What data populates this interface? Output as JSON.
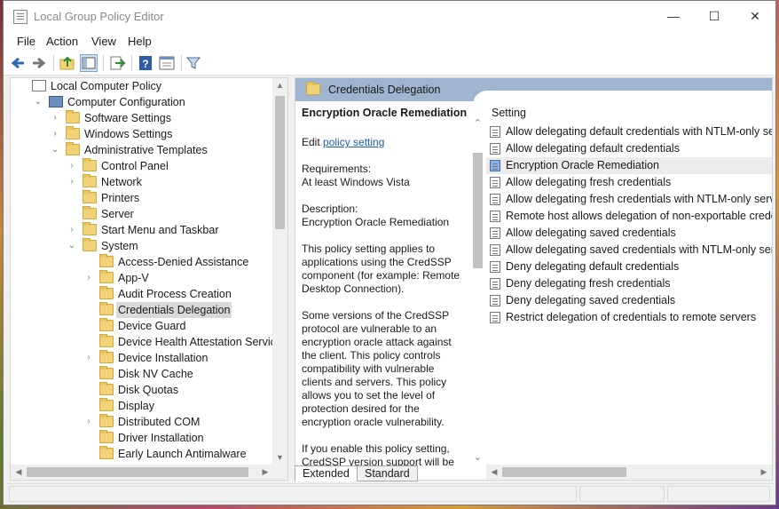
{
  "window": {
    "title": "Local Group Policy Editor",
    "minimize_glyph": "—",
    "maximize_glyph": "☐",
    "close_glyph": "✕"
  },
  "menu": [
    "File",
    "Action",
    "View",
    "Help"
  ],
  "toolbar": {
    "icons": [
      "back-arrow-icon",
      "forward-arrow-icon",
      "up-folder-icon",
      "show-hide-tree-icon",
      "export-list-icon",
      "help-icon",
      "properties-icon",
      "filter-icon"
    ]
  },
  "tree": [
    {
      "label": "Local Computer Policy",
      "indent": 0,
      "chevron": "",
      "icon": "policy-icon"
    },
    {
      "label": "Computer Configuration",
      "indent": 1,
      "chevron": "⌄",
      "icon": "computer-icon"
    },
    {
      "label": "Software Settings",
      "indent": 2,
      "chevron": "›",
      "icon": "folder-icon"
    },
    {
      "label": "Windows Settings",
      "indent": 2,
      "chevron": "›",
      "icon": "folder-icon"
    },
    {
      "label": "Administrative Templates",
      "indent": 2,
      "chevron": "⌄",
      "icon": "folder-icon"
    },
    {
      "label": "Control Panel",
      "indent": 3,
      "chevron": "›",
      "icon": "folder-icon"
    },
    {
      "label": "Network",
      "indent": 3,
      "chevron": "›",
      "icon": "folder-icon"
    },
    {
      "label": "Printers",
      "indent": 3,
      "chevron": "",
      "icon": "folder-icon"
    },
    {
      "label": "Server",
      "indent": 3,
      "chevron": "",
      "icon": "folder-icon"
    },
    {
      "label": "Start Menu and Taskbar",
      "indent": 3,
      "chevron": "›",
      "icon": "folder-icon"
    },
    {
      "label": "System",
      "indent": 3,
      "chevron": "⌄",
      "icon": "folder-icon"
    },
    {
      "label": "Access-Denied Assistance",
      "indent": 4,
      "chevron": "",
      "icon": "folder-icon"
    },
    {
      "label": "App-V",
      "indent": 4,
      "chevron": "›",
      "icon": "folder-icon"
    },
    {
      "label": "Audit Process Creation",
      "indent": 4,
      "chevron": "",
      "icon": "folder-icon"
    },
    {
      "label": "Credentials Delegation",
      "indent": 4,
      "chevron": "",
      "icon": "folder-icon",
      "selected": true
    },
    {
      "label": "Device Guard",
      "indent": 4,
      "chevron": "",
      "icon": "folder-icon"
    },
    {
      "label": "Device Health Attestation Service",
      "indent": 4,
      "chevron": "",
      "icon": "folder-icon"
    },
    {
      "label": "Device Installation",
      "indent": 4,
      "chevron": "›",
      "icon": "folder-icon"
    },
    {
      "label": "Disk NV Cache",
      "indent": 4,
      "chevron": "",
      "icon": "folder-icon"
    },
    {
      "label": "Disk Quotas",
      "indent": 4,
      "chevron": "",
      "icon": "folder-icon"
    },
    {
      "label": "Display",
      "indent": 4,
      "chevron": "",
      "icon": "folder-icon"
    },
    {
      "label": "Distributed COM",
      "indent": 4,
      "chevron": "›",
      "icon": "folder-icon"
    },
    {
      "label": "Driver Installation",
      "indent": 4,
      "chevron": "",
      "icon": "folder-icon"
    },
    {
      "label": "Early Launch Antimalware",
      "indent": 4,
      "chevron": "",
      "icon": "folder-icon"
    }
  ],
  "right": {
    "header": "Credentials Delegation",
    "extended": {
      "title": "Encryption Oracle Remediation",
      "edit_prefix": "Edit ",
      "edit_link": "policy setting",
      "requirements_label": "Requirements:",
      "requirements": "At least Windows Vista",
      "description_label": "Description:",
      "description": "Encryption Oracle Remediation",
      "para1": [
        "This policy setting applies to",
        "applications using the CredSSP",
        "component (for example: Remote",
        "Desktop Connection)."
      ],
      "para2": [
        "Some versions of the CredSSP",
        "protocol are vulnerable to an",
        "encryption oracle attack against",
        "the client.  This policy controls",
        "compatibility with vulnerable",
        "clients and servers.  This policy",
        "allows you to set the level of",
        "protection desired for the",
        "encryption oracle vulnerability."
      ],
      "para3": [
        "If you enable this policy setting,",
        "CredSSP version support will be"
      ]
    },
    "column_header": "Setting",
    "settings": [
      "Allow delegating default credentials with NTLM-only serv",
      "Allow delegating default credentials",
      "Encryption Oracle Remediation",
      "Allow delegating fresh credentials",
      "Allow delegating fresh credentials with NTLM-only server",
      "Remote host allows delegation of non-exportable credent",
      "Allow delegating saved credentials",
      "Allow delegating saved credentials with NTLM-only serve",
      "Deny delegating default credentials",
      "Deny delegating fresh credentials",
      "Deny delegating saved credentials",
      "Restrict delegation of credentials to remote servers"
    ],
    "selected_setting": "Encryption Oracle Remediation"
  },
  "tabs": [
    "Extended",
    "Standard"
  ],
  "active_tab": "Extended"
}
